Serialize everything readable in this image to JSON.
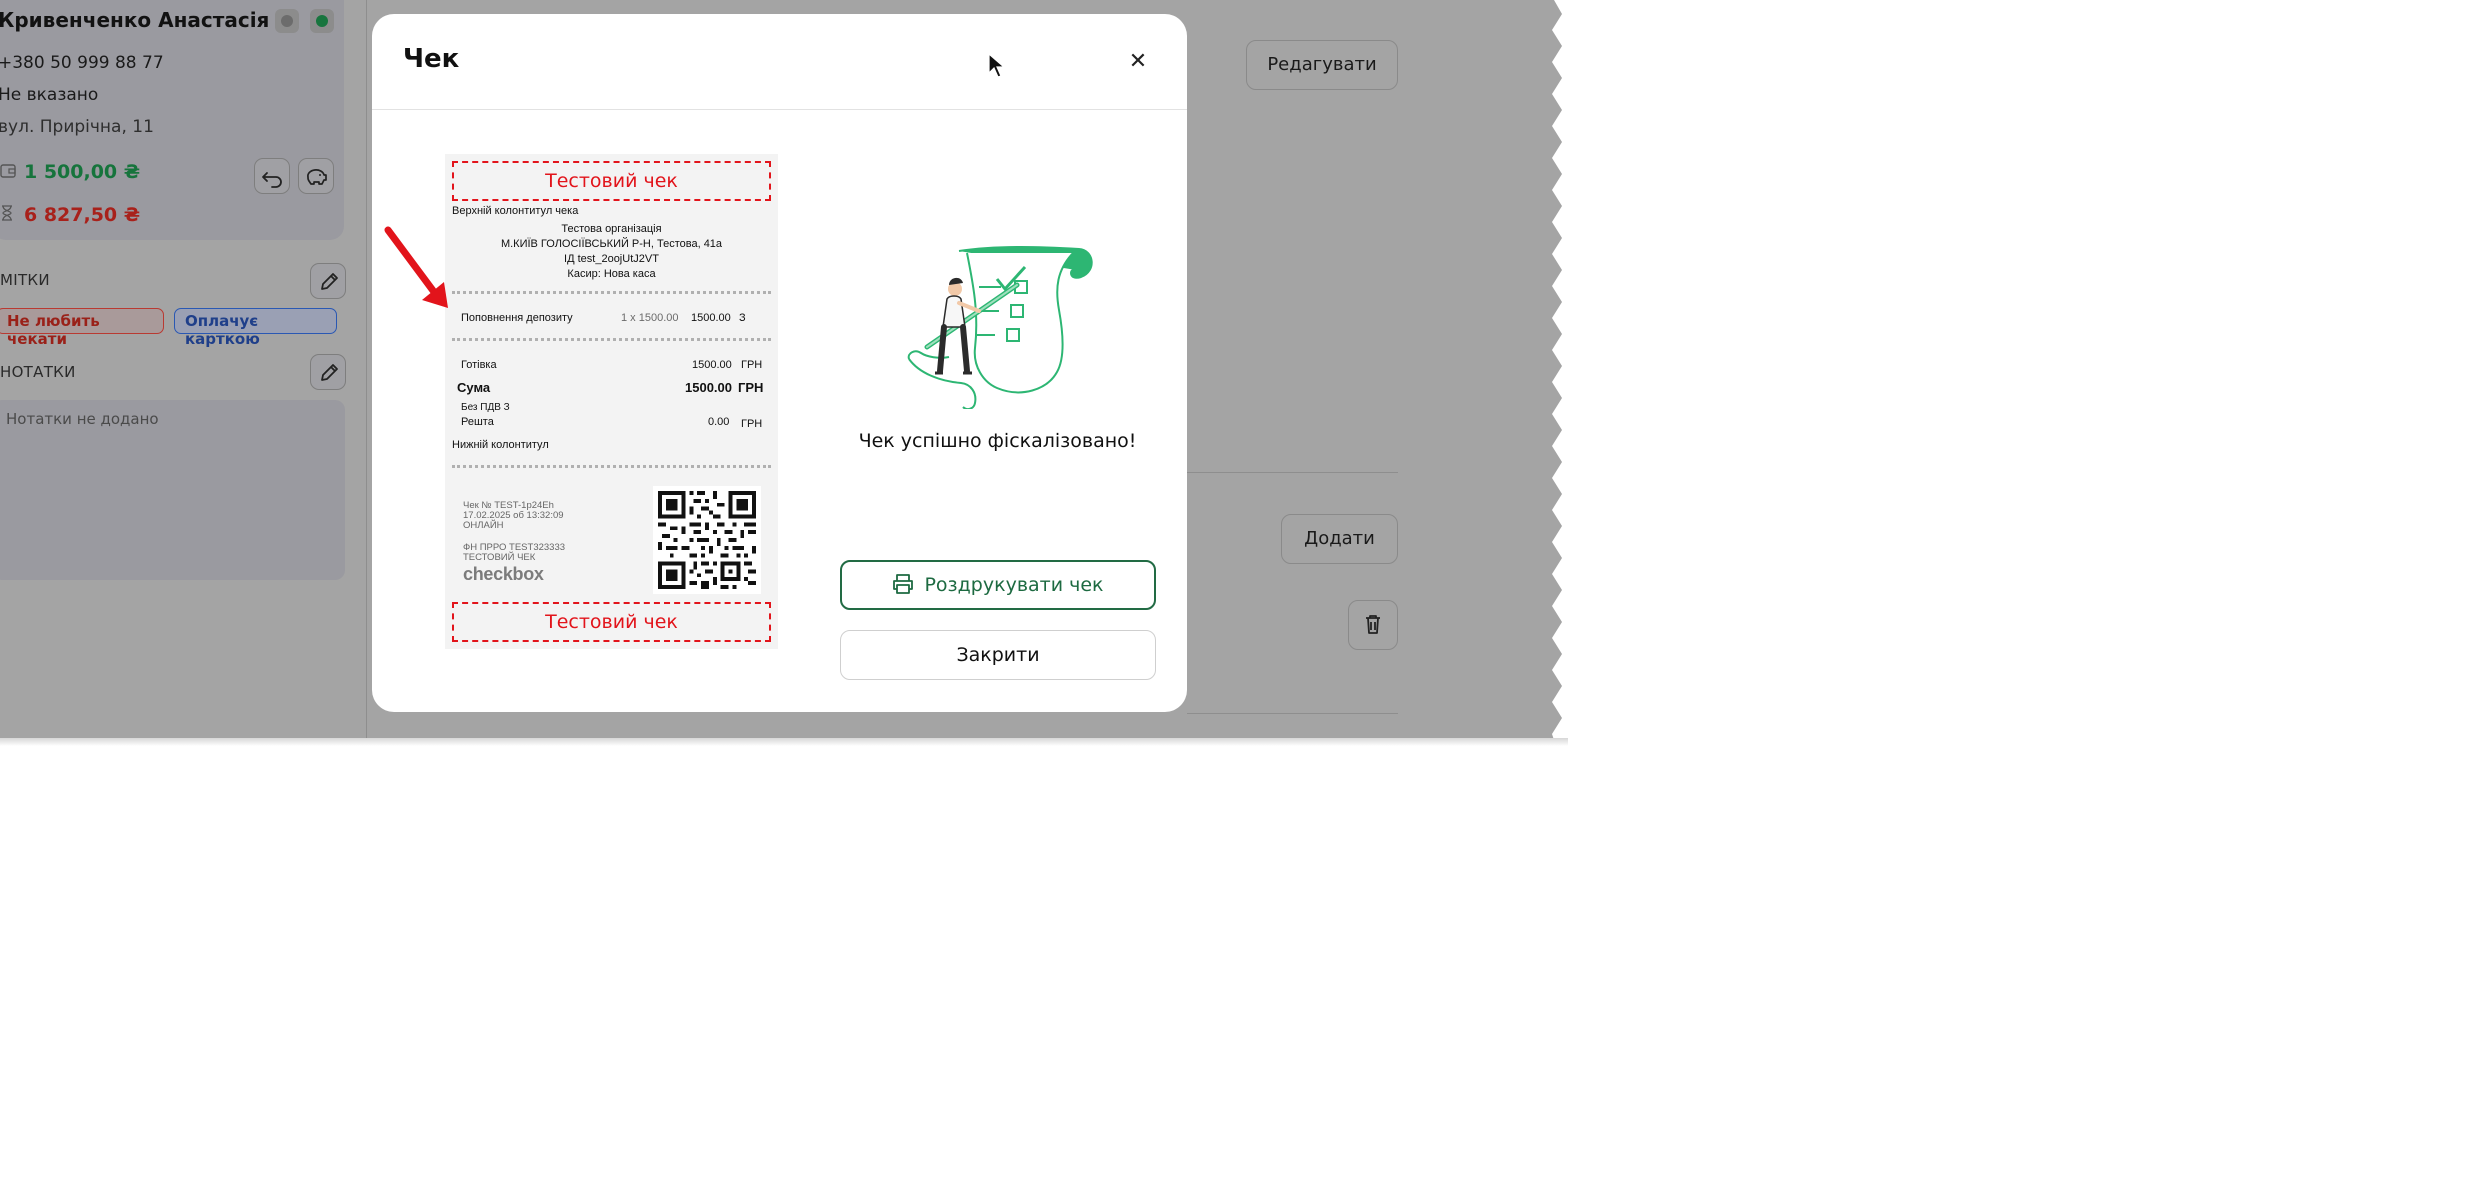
{
  "customer": {
    "name": "Кривенченко Анастасія",
    "phone": "+380 50 999 88 77",
    "field": "Не вказано",
    "address": "вул. Прирічна, 11",
    "deposit": "1 500,00 ₴",
    "debt": "6 827,50 ₴"
  },
  "tags_section": {
    "label": "МІТКИ",
    "tags": [
      "Не любить чекати",
      "Оплачує карткою"
    ]
  },
  "notes_section": {
    "label": "НОТАТКИ",
    "placeholder": "Нотатки не додано"
  },
  "background": {
    "edit_button": "Редагувати",
    "add_button": "Додати"
  },
  "modal": {
    "title": "Чек",
    "close_icon": "close-icon",
    "success_message": "Чек успішно фіскалізовано!",
    "print_button": "Роздрукувати чек",
    "close_button": "Закрити"
  },
  "receipt": {
    "test_banner": "Тестовий чек",
    "header": "Верхній колонтитул чека",
    "org": "Тестова організація",
    "address": "М.КИЇВ ГОЛОСІЇВСЬКИЙ Р-Н, Тестова, 41а",
    "id_line": "ІД test_2oojUtJ2VT",
    "cashier": "Касир: Нова каса",
    "item": {
      "name": "Поповнення депозиту",
      "qty": "1 x 1500.00",
      "sum": "1500.00",
      "tax": "З"
    },
    "cash": {
      "label": "Готівка",
      "value": "1500.00",
      "cur": "ГРН"
    },
    "total": {
      "label": "Сума",
      "value": "1500.00",
      "cur": "ГРН"
    },
    "vat": "Без ПДВ З",
    "change": {
      "label": "Решта",
      "value": "0.00",
      "cur": "ГРН"
    },
    "footer": "Нижній колонтитул",
    "meta": [
      "Чек № TEST-1p24Eh",
      "17.02.2025 об 13:32:09",
      "ОНЛАЙН",
      "ФН ПРРО TEST323333",
      "ТЕСТОВИЙ ЧЕК"
    ],
    "brand": "checkbox"
  },
  "colors": {
    "accent_green": "#1d6a41",
    "deposit_green": "#16743c",
    "debt_red": "#a8211b",
    "test_red": "#e2141b"
  }
}
